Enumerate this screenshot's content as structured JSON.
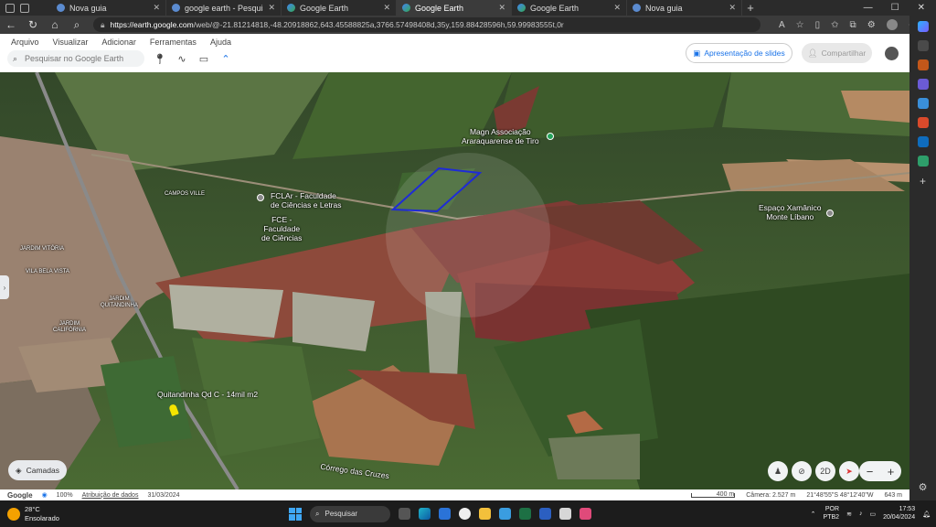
{
  "browser": {
    "tabs": [
      {
        "label": "Nova guia",
        "active": false
      },
      {
        "label": "google earth - Pesquisar",
        "active": false
      },
      {
        "label": "Google Earth",
        "active": false
      },
      {
        "label": "Google Earth",
        "active": true
      },
      {
        "label": "Google Earth",
        "active": false
      },
      {
        "label": "Nova guia",
        "active": false
      }
    ],
    "url_host": "https://earth.google.com",
    "url_path": "/web/@-21.81214818,-48.20918862,643.45588825a,3766.57498408d,35y,159.88428596h,59.99983555t,0r"
  },
  "menu": [
    "Arquivo",
    "Visualizar",
    "Adicionar",
    "Ferramentas",
    "Ajuda"
  ],
  "search": {
    "placeholder": "Pesquisar no Google Earth"
  },
  "header": {
    "slides_label": "Apresentação de slides",
    "share_label": "Compartilhar"
  },
  "map_labels": {
    "magn": "Magn Associação\nAraraquarense de Tiro",
    "fclar": "FCLAr - Faculdade\nde Ciências e Letras",
    "fce": "FCE -\nFaculdade\nde Ciências",
    "espaco": "Espaço Xamânico\nMonte Líbano",
    "quitandinha": "Quitandinha Qd C - 14mil m2",
    "corrego": "Córrego das Cruzes",
    "campos_ville": "CAMPOS VILLE",
    "jardim_vitoria": "JARDIM VITÓRIA",
    "vila_bela_vista": "VILA BELA VISTA",
    "jardim_quitandinha": "JARDIM\nQUITANDINHA",
    "jardim_california": "JARDIM\nCALIFÓRNIA"
  },
  "controls": {
    "layers_label": "Camadas",
    "view_2d": "2D"
  },
  "status": {
    "brand": "Google",
    "zoom": "100%",
    "attribution": "Atribuição de dados",
    "date": "31/03/2024",
    "scale": "400 m",
    "camera": "Câmera: 2.527 m",
    "coords": "21°48'55\"S 48°12'40\"W",
    "elevation": "643 m"
  },
  "taskbar": {
    "temp": "28°C",
    "condition": "Ensolarado",
    "search_placeholder": "Pesquisar",
    "lang_1": "POR",
    "lang_2": "PTB2",
    "time": "17:53",
    "date": "20/04/2024"
  },
  "colors": {
    "accent": "#1a73e8",
    "polygon": "#1e2bd6",
    "pin": "#f5e400"
  }
}
